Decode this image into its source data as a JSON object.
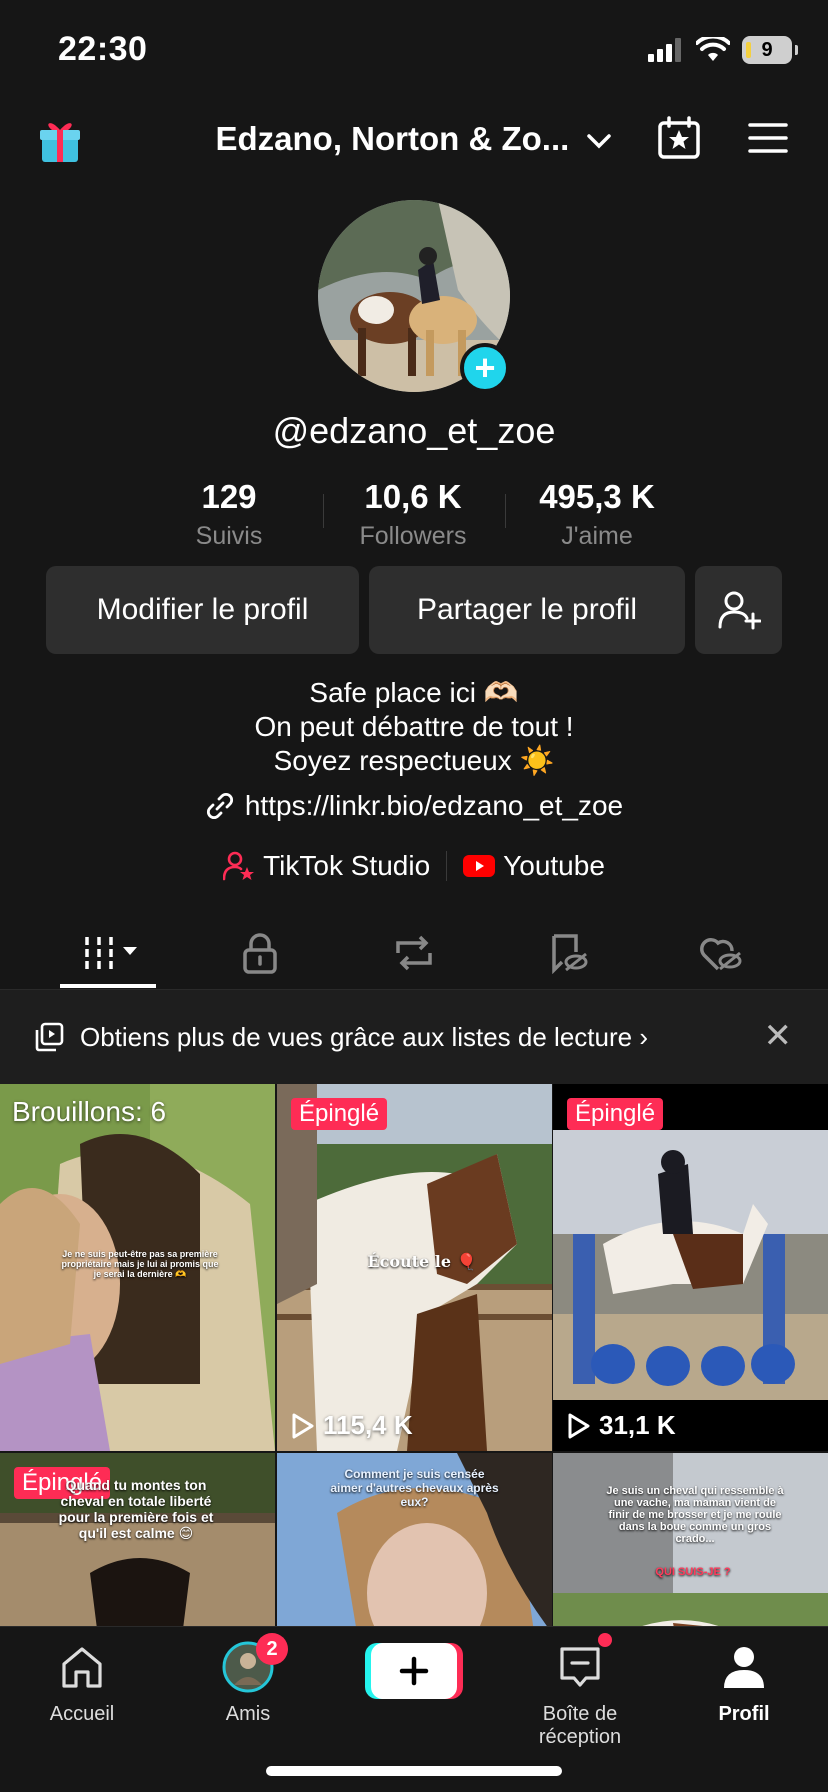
{
  "status_bar": {
    "time": "22:30",
    "battery": "9"
  },
  "header": {
    "title": "Edzano, Norton & Zo..."
  },
  "profile": {
    "username": "@edzano_et_zoe",
    "stats": [
      {
        "value": "129",
        "label": "Suivis"
      },
      {
        "value": "10,6 K",
        "label": "Followers"
      },
      {
        "value": "495,3 K",
        "label": "J'aime"
      }
    ],
    "edit_button": "Modifier le profil",
    "share_button": "Partager le profil",
    "bio_lines": [
      "Safe place ici 🫶🏻",
      "On peut débattre de tout !",
      "Soyez respectueux ☀️"
    ],
    "link": "https://linkr.bio/edzano_et_zoe",
    "studio_link": "TikTok Studio",
    "youtube_link": "Youtube"
  },
  "banner": {
    "text": "Obtiens plus de vues grâce aux listes de lecture"
  },
  "grid": {
    "draft_label": "Brouillons: 6",
    "pinned_label": "Épinglé",
    "videos": [
      {
        "views": "115,4 K",
        "overlay": "Écoute le 🎈"
      },
      {
        "views": "31,1 K"
      }
    ],
    "draft_overlay": "Je ne suis peut-être pas sa première propriétaire mais je lui ai promis que je serai la dernière 🫶",
    "row2": [
      {
        "overlay": "Quand tu montes ton cheval en totale liberté pour la première fois et qu'il est calme 😊"
      },
      {
        "overlay": "Comment je suis censée aimer d'autres chevaux après eux?"
      },
      {
        "overlay": "Je suis un cheval qui ressemble à une vache, ma maman vient de finir de me brosser et je me roule dans la boue comme un gros crado...",
        "overlay2": "QUI SUIS-JE ?"
      }
    ]
  },
  "bottom_nav": {
    "home": "Accueil",
    "friends": "Amis",
    "friends_badge": "2",
    "inbox": "Boîte de réception",
    "profile": "Profil"
  }
}
